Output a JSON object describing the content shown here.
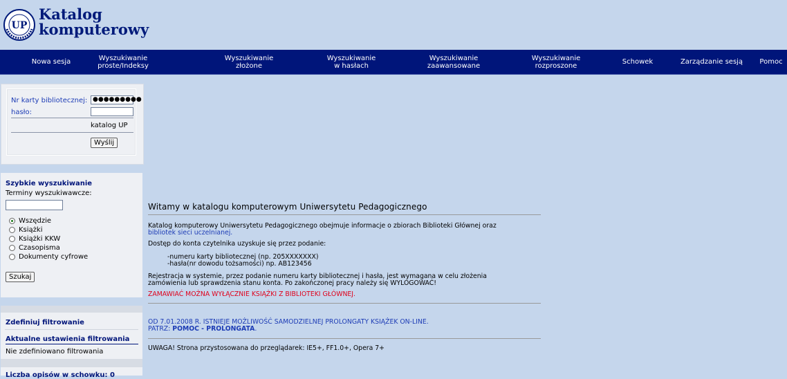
{
  "logo": {
    "emblem_text": "UP",
    "emblem_ring_text": "Biblioteka Główna",
    "title_line1": "Katalog",
    "title_line2": "komputerowy"
  },
  "nav": {
    "items": [
      {
        "label": "Nowa sesja"
      },
      {
        "label": "Wyszukiwanie\nproste/Indeksy"
      },
      {
        "label": "Wyszukiwanie\nzłożone"
      },
      {
        "label": "Wyszukiwanie\nw hasłach"
      },
      {
        "label": "Wyszukiwanie\nzaawansowane"
      },
      {
        "label": "Wyszukiwanie\nrozproszone"
      },
      {
        "label": "Schowek"
      },
      {
        "label": "Zarządzanie sesją"
      },
      {
        "label": "Pomoc"
      }
    ]
  },
  "login": {
    "card_label": "Nr karty bibliotecznej:",
    "card_value": "●●●●●●●●●",
    "password_label": "hasło:",
    "password_value": "",
    "catalog_label": "katalog UP",
    "submit_label": "Wyślij"
  },
  "quick_search": {
    "title": "Szybkie wyszukiwanie",
    "terms_label": "Terminy wyszukiwawcze:",
    "terms_value": "",
    "options": [
      {
        "label": "Wszędzie",
        "selected": true
      },
      {
        "label": "Książki",
        "selected": false
      },
      {
        "label": "Książki KKW",
        "selected": false
      },
      {
        "label": "Czasopisma",
        "selected": false
      },
      {
        "label": "Dokumenty cyfrowe",
        "selected": false
      }
    ],
    "submit_label": "Szukaj"
  },
  "filter": {
    "define_link": "Zdefiniuj filtrowanie",
    "current_heading": "Aktualne ustawienia filtrowania",
    "current_value": "Nie zdefiniowano filtrowania",
    "records_label": "Liczba opisów w schowku: 0"
  },
  "main": {
    "title": "Witamy w katalogu komputerowym Uniwersytetu Pedagogicznego",
    "intro": "Katalog komputerowy Uniwersytetu Pedagogicznego obejmuje informacje o zbiorach Biblioteki Głównej oraz",
    "intro_link": "bibliotek sieci uczelnianej.",
    "access_text": "Dostęp do konta czytelnika uzyskuje się przez podanie:",
    "access_item1": "-numeru karty bibliotecznej (np. 205XXXXXXX)",
    "access_item2": "-hasła(nr dowodu tożsamości) np. AB123456",
    "registration_line1": "Rejestracja w systemie, przez podanie numeru karty bibliotecznej i hasła, jest wymagana w celu złożenia",
    "registration_line2": "zamówienia lub sprawdzenia stanu konta. Po zakończonej pracy należy się WYLOGOWAĆ!",
    "red_notice": "ZAMAWIAĆ MOŻNA WYŁĄCZNIE KSIĄŻKI Z BIBLIOTEKI GŁÓWNEJ.",
    "prolong_line1": "OD 7.01.2008 R. ISTNIEJE MOŻLIWOŚĆ SAMODZIELNEJ PROLONGATY KSIĄŻEK ON-LINE.",
    "prolong_prefix": "PATRZ: ",
    "prolong_link": "POMOC - PROLONGATA",
    "prolong_suffix": ".",
    "browser_note": "UWAGA! Strona przystosowana do przeglądarek: IE5+, FF1.0+, Opera 7+"
  },
  "colors": {
    "page_bg": "#c5d6ec",
    "nav_bg": "#00157a",
    "panel_bg": "#eef0f4",
    "link_blue": "#1c3bb5",
    "alert_red": "#e0001a"
  }
}
